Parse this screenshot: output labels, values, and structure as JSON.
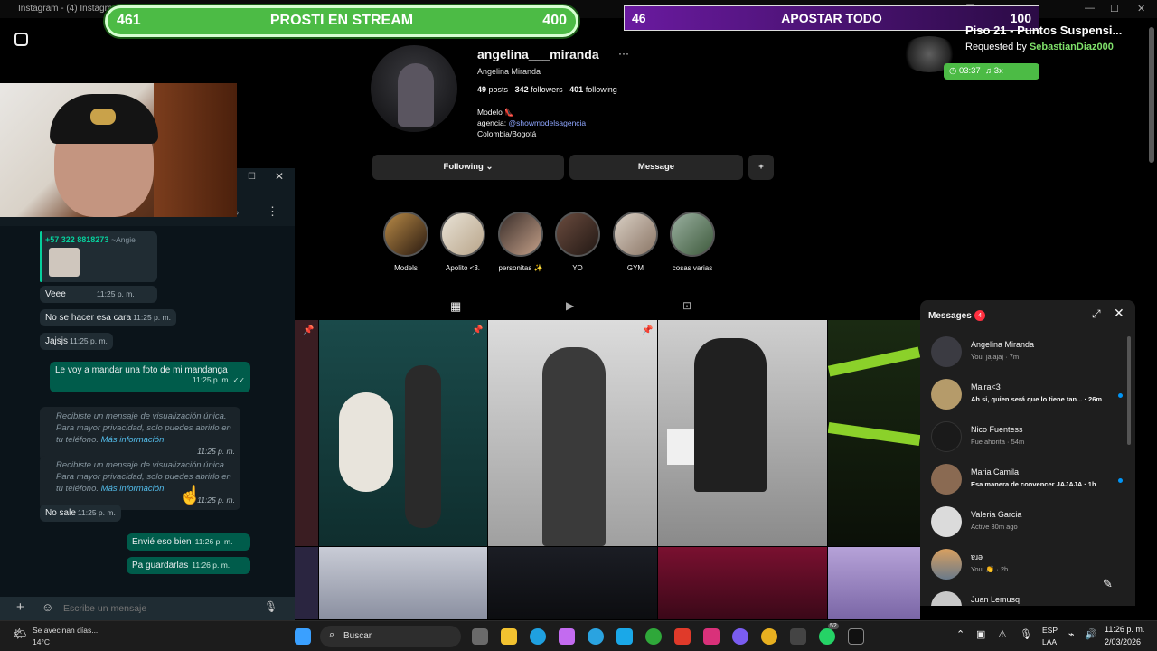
{
  "window": {
    "title": "Instagram - (4) Instagram"
  },
  "overlay": {
    "green_left": "461",
    "green_title": "PROSTI EN STREAM",
    "green_right": "400",
    "purple_left": "46",
    "purple_title": "APOSTAR TODO",
    "purple_right": "100",
    "song_title": "Piso 21 - Puntos Suspensi...",
    "requested_prefix": "Requested by ",
    "requested_by": "SebastianDiaz000",
    "song_time": "03:37",
    "song_mult": "3x"
  },
  "profile": {
    "username": "angelina___miranda",
    "display_name": "Angelina Miranda",
    "posts": "49",
    "posts_label": "posts",
    "followers": "342",
    "followers_label": "followers",
    "following": "401",
    "following_label": "following",
    "bio_line1": "Modelo",
    "bio_agencia": "agencia:",
    "bio_link": "@showmodelsagencia",
    "bio_location": "Colombia/Bogotá",
    "following_btn": "Following",
    "message_btn": "Message"
  },
  "stories": [
    {
      "label": "Models"
    },
    {
      "label": "Apolito <3."
    },
    {
      "label": "personitas ✨"
    },
    {
      "label": "YO"
    },
    {
      "label": "GYM"
    },
    {
      "label": "cosas varias"
    }
  ],
  "messages_panel": {
    "title": "Messages",
    "badge": "4",
    "items": [
      {
        "name": "Angelina Miranda",
        "preview": "You: jajajaj · 7m",
        "unread": false
      },
      {
        "name": "Maira<3",
        "preview": "Ah si, quien será que lo tiene tan... · 26m",
        "unread": true
      },
      {
        "name": "Nico Fuentess",
        "preview": "Fue ahorita · 54m",
        "unread": false
      },
      {
        "name": "Maria Camila",
        "preview": "Esa manera de convencer JAJAJA · 1h",
        "unread": true
      },
      {
        "name": "Valeria Garcia",
        "preview": "Active 30m ago",
        "unread": false
      },
      {
        "name": "ɐɹǝ",
        "preview": "You: 👏 · 2h",
        "unread": false
      },
      {
        "name": "Juan Lemusq",
        "preview": "",
        "unread": false
      }
    ]
  },
  "whatsapp": {
    "quoted_number": "+57 322 8818273",
    "quoted_name": "~Angie",
    "messages": [
      {
        "text": "Veee",
        "time": "11:25 p. m."
      },
      {
        "text": "No se hacer esa cara",
        "time": "11:25 p. m."
      },
      {
        "text": "Jajsjs",
        "time": "11:25 p. m."
      },
      {
        "text": "Le voy a mandar una foto de mi mandanga",
        "time": "11:25 p. m."
      },
      {
        "text": "Recibiste un mensaje de visualización única. Para mayor privacidad, solo puedes abrirlo en tu teléfono.",
        "link": "Más información",
        "time": "11:25 p. m."
      },
      {
        "text": "Recibiste un mensaje de visualización única. Para mayor privacidad, solo puedes abrirlo en tu teléfono.",
        "link": "Más información",
        "time": "11:25 p. m."
      },
      {
        "text": "No sale",
        "time": "11:25 p. m."
      },
      {
        "text": "Envié eso bien",
        "time": "11:26 p. m."
      },
      {
        "text": "Pa guardarlas",
        "time": "11:26 p. m."
      }
    ],
    "input_placeholder": "Escribe un mensaje"
  },
  "taskbar": {
    "weather_text": "Se avecinan días...",
    "temperature": "14°C",
    "search_label": "Buscar",
    "lang1": "ESP",
    "lang2": "LAA",
    "time": "11:26 p. m.",
    "date": "2/03/2026",
    "wa_badge": "52"
  }
}
